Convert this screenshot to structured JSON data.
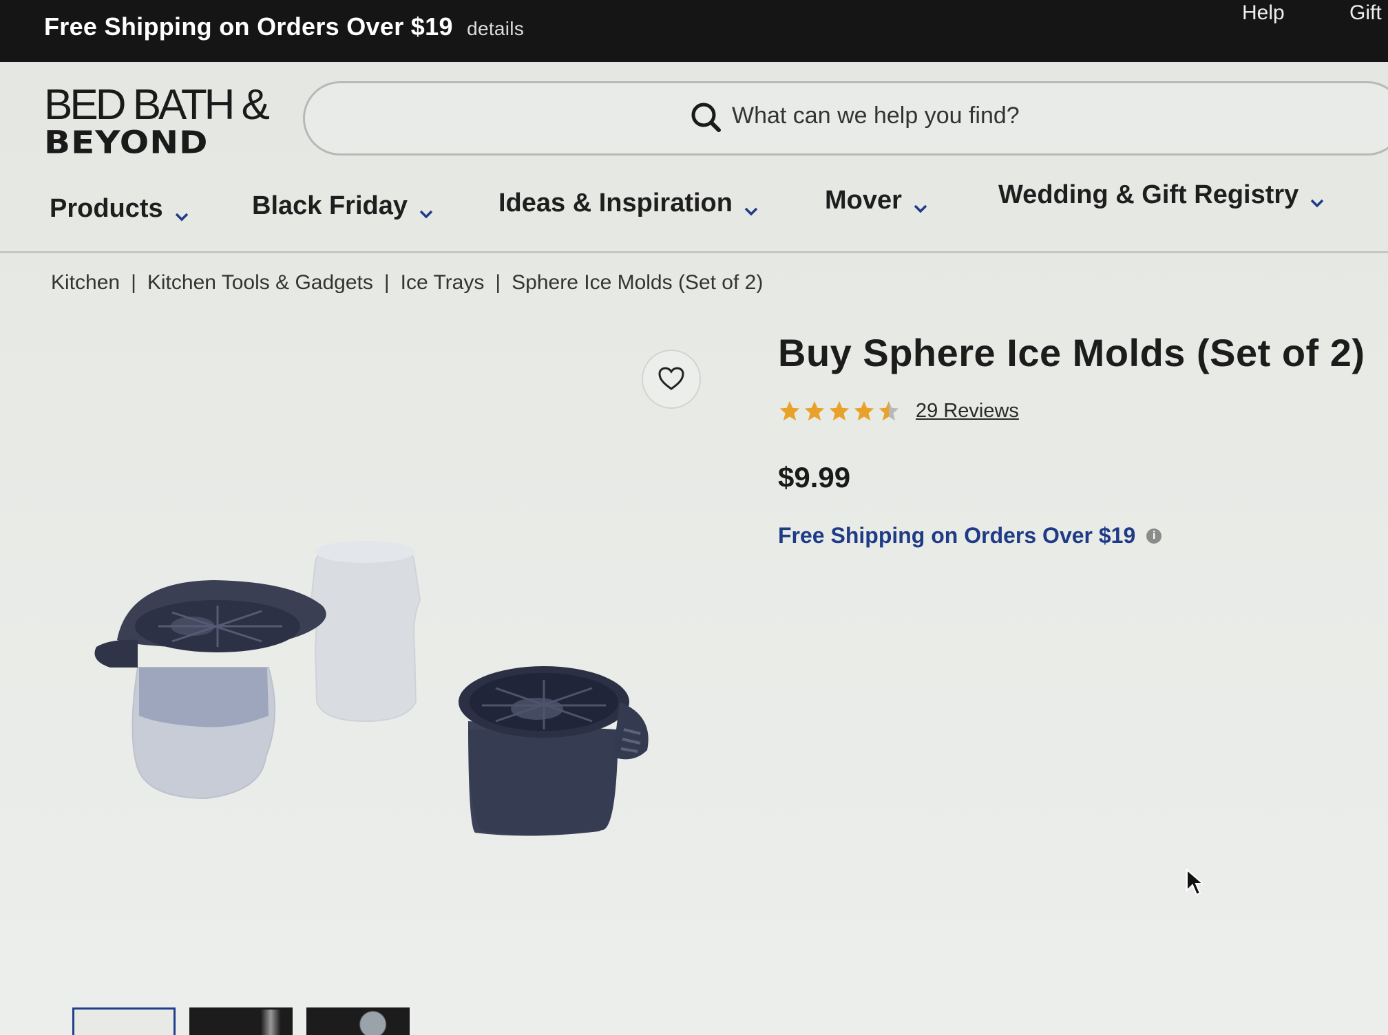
{
  "topbar": {
    "promo": "Free Shipping on Orders Over $19",
    "details_link": "details",
    "help": "Help",
    "gift": "Gift"
  },
  "header": {
    "logo_line1": "BED BATH &",
    "logo_line2": "BEYOND",
    "search_placeholder": "What can we help you find?"
  },
  "nav": {
    "items": [
      {
        "label": "Products"
      },
      {
        "label": "Black Friday"
      },
      {
        "label": "Ideas & Inspiration"
      },
      {
        "label": "Mover"
      },
      {
        "label": "Wedding & Gift Registry"
      }
    ]
  },
  "breadcrumb": {
    "items": [
      "Kitchen",
      "Kitchen Tools & Gadgets",
      "Ice Trays",
      "Sphere Ice Molds (Set of 2)"
    ]
  },
  "product": {
    "title": "Buy Sphere Ice Molds (Set of 2)",
    "rating": 4.5,
    "reviews_label": "29 Reviews",
    "price": "$9.99",
    "shipping_note": "Free Shipping on Orders Over $19"
  },
  "colors": {
    "topbar_bg": "#151515",
    "link_blue": "#1f3b86",
    "star_gold": "#e8a22a"
  }
}
